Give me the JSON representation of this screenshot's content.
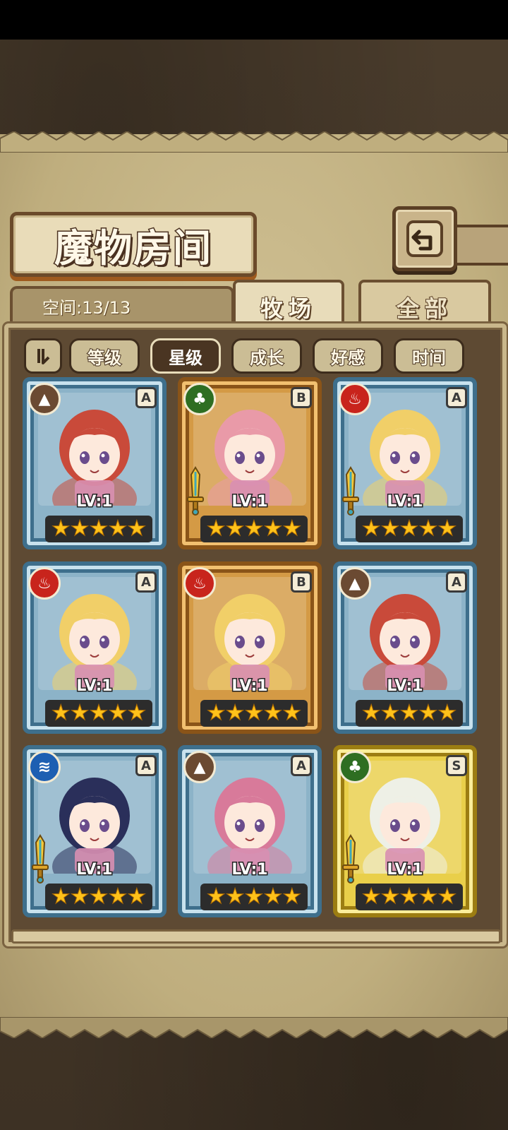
{
  "header": {
    "title": "魔物房间"
  },
  "space": {
    "label": "空间:13/13"
  },
  "tabs": [
    {
      "label": "牧场",
      "active": true
    },
    {
      "label": "全部",
      "active": false
    }
  ],
  "sort": {
    "toggle_icon": "sort-order-icon",
    "buttons": [
      {
        "label": "等级",
        "active": false
      },
      {
        "label": "星级",
        "active": true
      },
      {
        "label": "成长",
        "active": false
      },
      {
        "label": "好感",
        "active": false
      },
      {
        "label": "时间",
        "active": false
      }
    ]
  },
  "monsters": [
    {
      "element": "earth",
      "rank": "A",
      "level": "LV:1",
      "stars": 5,
      "frame": "blue",
      "weapon": false,
      "hair": "#c94a3a"
    },
    {
      "element": "nature",
      "rank": "B",
      "level": "LV:1",
      "stars": 5,
      "frame": "gold",
      "weapon": true,
      "hair": "#e99aa8"
    },
    {
      "element": "fire",
      "rank": "A",
      "level": "LV:1",
      "stars": 5,
      "frame": "blue",
      "weapon": true,
      "hair": "#f1cf68"
    },
    {
      "element": "fire",
      "rank": "A",
      "level": "LV:1",
      "stars": 5,
      "frame": "blue",
      "weapon": false,
      "hair": "#f1cf68"
    },
    {
      "element": "fire",
      "rank": "B",
      "level": "LV:1",
      "stars": 5,
      "frame": "gold",
      "weapon": false,
      "hair": "#f1cf68"
    },
    {
      "element": "earth",
      "rank": "A",
      "level": "LV:1",
      "stars": 5,
      "frame": "blue",
      "weapon": false,
      "hair": "#c94a3a"
    },
    {
      "element": "water",
      "rank": "A",
      "level": "LV:1",
      "stars": 5,
      "frame": "blue",
      "weapon": true,
      "hair": "#2a2f5a"
    },
    {
      "element": "earth",
      "rank": "A",
      "level": "LV:1",
      "stars": 5,
      "frame": "blue",
      "weapon": false,
      "hair": "#d87a9a"
    },
    {
      "element": "nature",
      "rank": "S",
      "level": "LV:1",
      "stars": 5,
      "frame": "yellow",
      "weapon": true,
      "hair": "#eef0e6"
    }
  ],
  "colors": {
    "fire": "#c8241c",
    "earth": "#6b4a32",
    "nature": "#2e6e22",
    "water": "#1d5fb2",
    "star": "#ffc21a"
  }
}
